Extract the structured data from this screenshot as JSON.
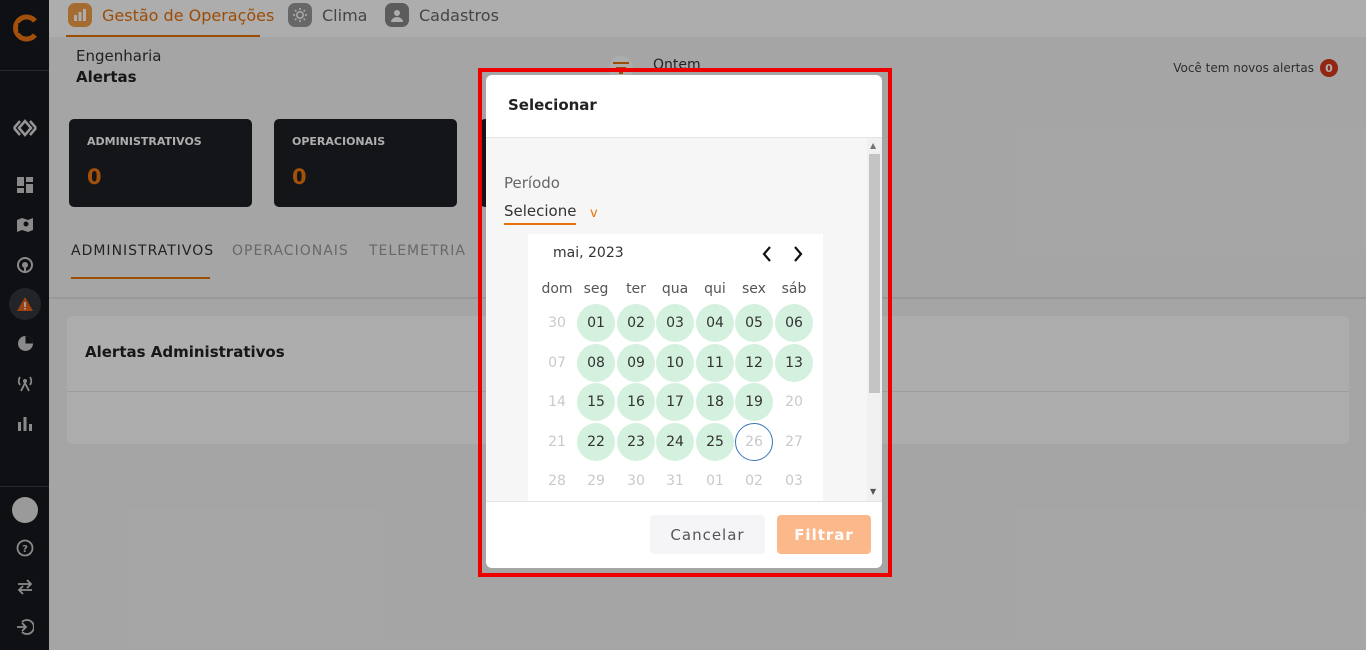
{
  "colors": {
    "accent": "#e8710a",
    "sidebar": "#16191d",
    "available_day": "#d4f0de",
    "badge": "#d7381c",
    "highlight_frame": "#ee0000"
  },
  "topnav": {
    "items": [
      {
        "label": "Gestão de Operações",
        "icon": "operations-chart-icon"
      },
      {
        "label": "Clima",
        "icon": "sun-icon"
      },
      {
        "label": "Cadastros",
        "icon": "user-icon"
      }
    ]
  },
  "subheader": {
    "breadcrumb": [
      "Engenharia",
      "Alertas"
    ],
    "filter_label": "Ontem",
    "alerts_text": "Você tem novos alertas",
    "alerts_count": "0"
  },
  "cards": [
    {
      "title": "ADMINISTRATIVOS",
      "value": "0"
    },
    {
      "title": "OPERACIONAIS",
      "value": "0"
    }
  ],
  "tabs": [
    "ADMINISTRATIVOS",
    "OPERACIONAIS",
    "TELEMETRIA"
  ],
  "panel": {
    "title": "Alertas Administrativos"
  },
  "modal": {
    "title": "Selecionar",
    "period_label": "Período",
    "select_placeholder": "Selecione",
    "select_arrow": "v",
    "calendar": {
      "month_label": "mai, 2023",
      "weekdays": [
        "dom",
        "seg",
        "ter",
        "qua",
        "qui",
        "sex",
        "sáb"
      ],
      "weeks": [
        [
          "30",
          "01",
          "02",
          "03",
          "04",
          "05",
          "06"
        ],
        [
          "07",
          "08",
          "09",
          "10",
          "11",
          "12",
          "13"
        ],
        [
          "14",
          "15",
          "16",
          "17",
          "18",
          "19",
          "20"
        ],
        [
          "21",
          "22",
          "23",
          "24",
          "25",
          "26",
          "27"
        ],
        [
          "28",
          "29",
          "30",
          "31",
          "01",
          "02",
          "03"
        ]
      ],
      "available_days": [
        "01",
        "02",
        "03",
        "04",
        "05",
        "06",
        "08",
        "09",
        "10",
        "11",
        "12",
        "13",
        "15",
        "16",
        "17",
        "18",
        "19",
        "22",
        "23",
        "24",
        "25"
      ],
      "today": "26"
    },
    "cancel_label": "Cancelar",
    "filter_label": "Filtrar"
  }
}
